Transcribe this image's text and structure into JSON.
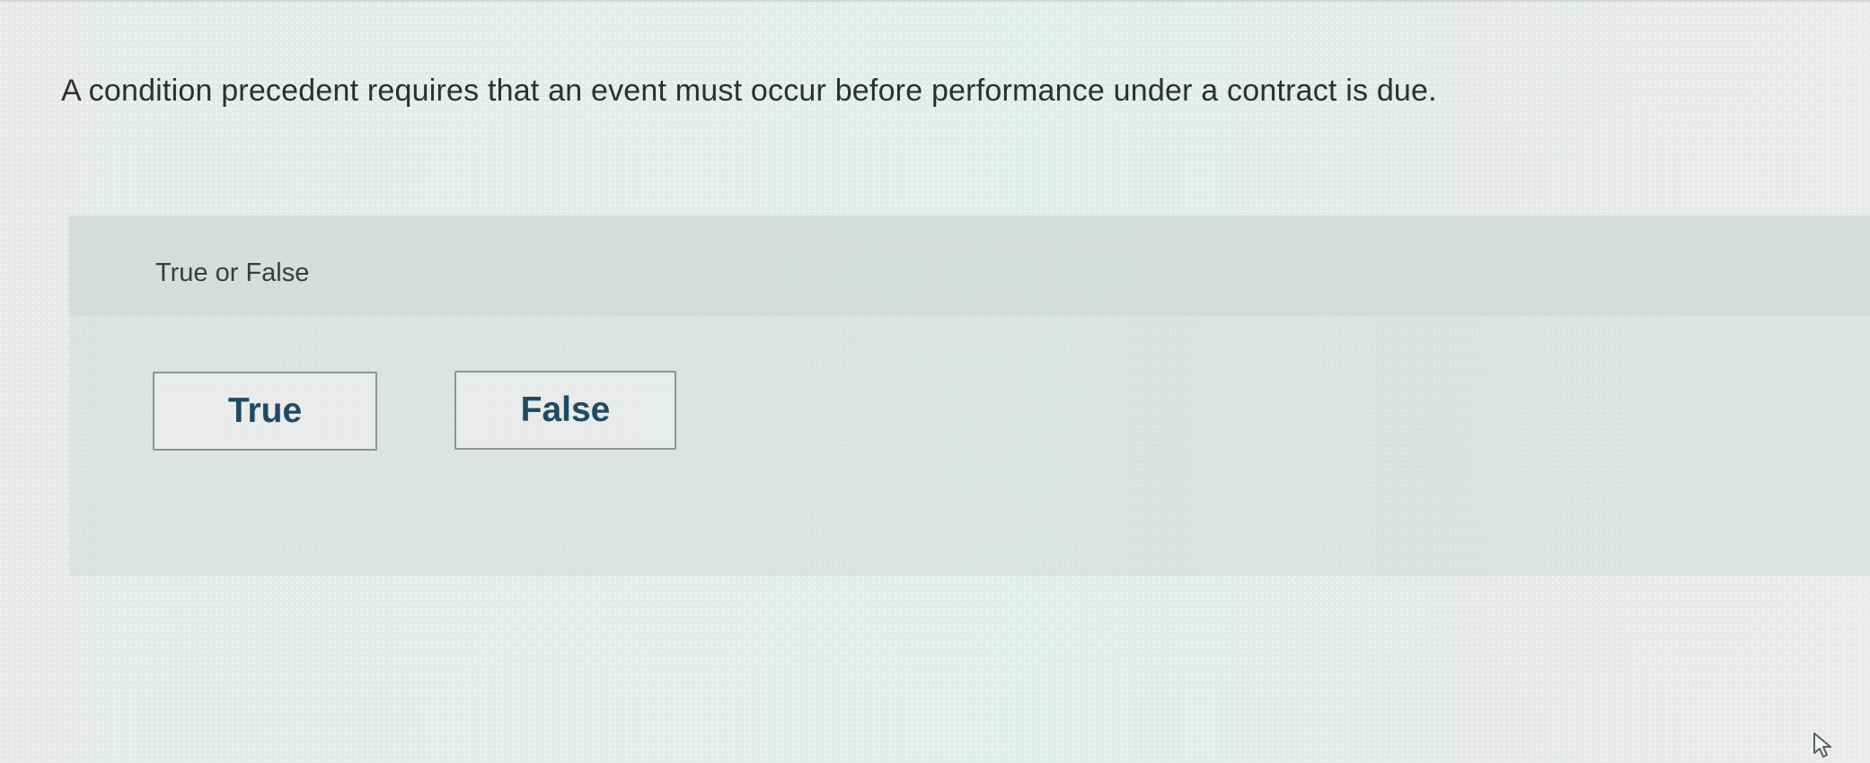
{
  "question": {
    "text": "A condition precedent requires that an event must occur before performance under a contract is due."
  },
  "answer_panel": {
    "prompt": "True or False",
    "options": [
      {
        "label": "True"
      },
      {
        "label": "False"
      }
    ]
  },
  "cursor": {
    "icon": "mouse-pointer-icon"
  },
  "colors": {
    "button_text": "#1f4a66",
    "button_border": "#8e9393",
    "question_text": "#2d2f30"
  }
}
